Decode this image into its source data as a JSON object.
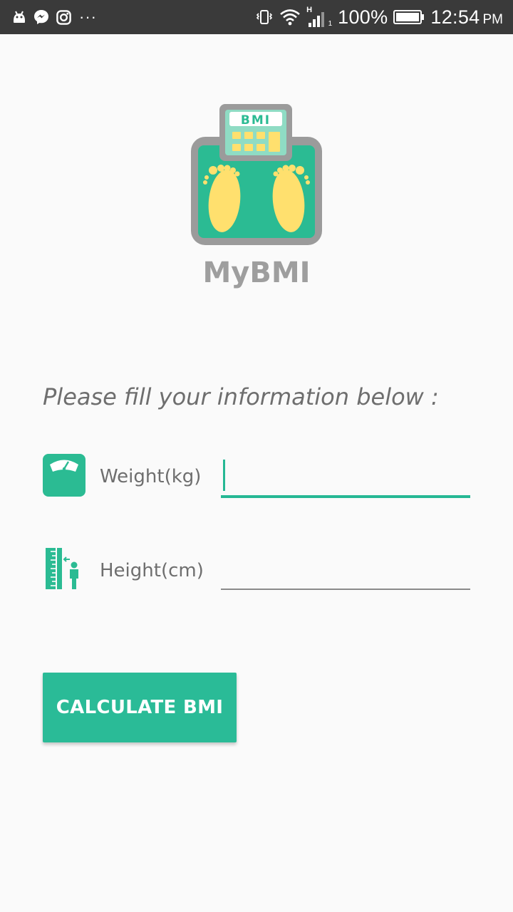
{
  "status_bar": {
    "left_icons": [
      "android-icon",
      "messenger-icon",
      "instagram-icon"
    ],
    "more": "···",
    "network": "H",
    "sim": "1",
    "battery": "100%",
    "time": "12:54",
    "ampm": "PM"
  },
  "app": {
    "logo_badge": "BMI",
    "title": "MyBMI",
    "instructions": "Please fill your information below :",
    "weight": {
      "label": "Weight(kg)",
      "value": "",
      "icon": "scale-icon"
    },
    "height": {
      "label": "Height(cm)",
      "value": "",
      "icon": "height-measure-icon"
    },
    "calculate_label": "CALCULATE BMI"
  },
  "colors": {
    "accent": "#2abb97",
    "status_bar": "#3a3a3a",
    "background": "#fafafa",
    "text_gray": "#6e6e6e",
    "title_gray": "#9e9e9e",
    "foot_yellow": "#ffe06e"
  }
}
